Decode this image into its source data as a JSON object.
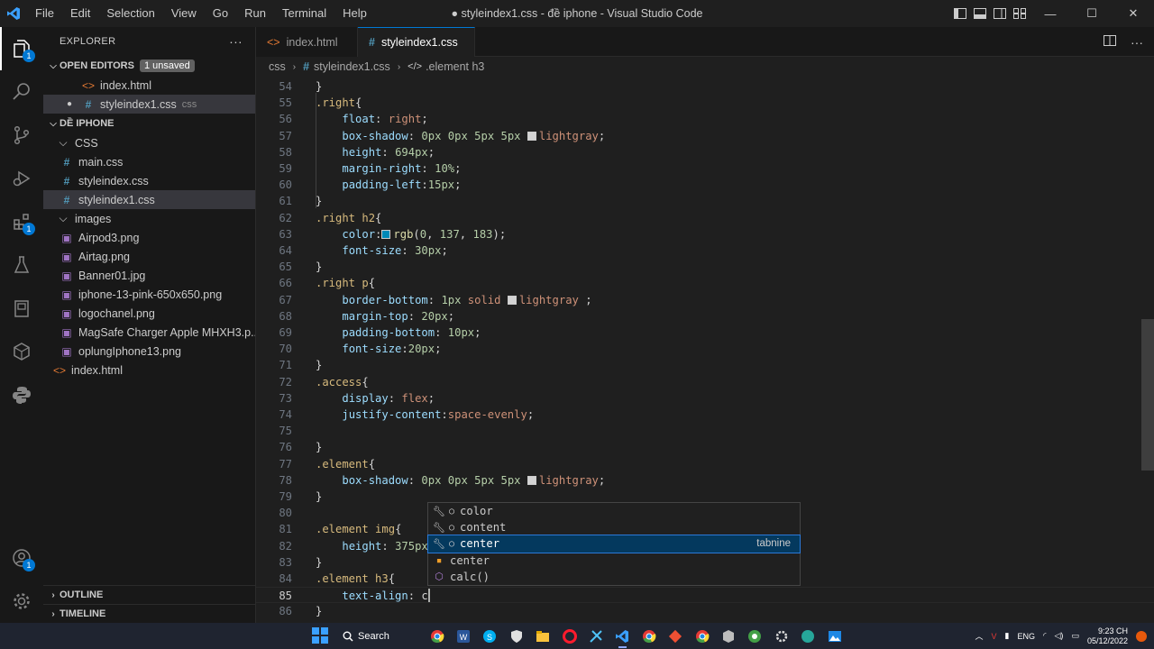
{
  "titlebar": {
    "menu": [
      "File",
      "Edit",
      "Selection",
      "View",
      "Go",
      "Run",
      "Terminal",
      "Help"
    ],
    "window_title": "● styleindex1.css - đề iphone - Visual Studio Code",
    "controls": [
      "—",
      "☐",
      "✕"
    ]
  },
  "activity_bar": {
    "items": [
      "explorer-icon",
      "search-icon",
      "source-control-icon",
      "run-debug-icon",
      "extensions-icon",
      "testing-icon",
      "remote-explorer-icon",
      "docker-icon",
      "python-icon"
    ],
    "explorer_badge": "1",
    "extensions_badge": "1",
    "accounts_badge": "1"
  },
  "sidebar": {
    "title": "EXPLORER",
    "more": "···",
    "open_editors": {
      "label": "OPEN EDITORS",
      "badge": "1 unsaved",
      "files": [
        {
          "name": "index.html",
          "hint": ""
        },
        {
          "name": "styleindex1.css",
          "hint": "css"
        }
      ]
    },
    "workspace": {
      "label": "DỀ IPHONE",
      "css_folder": "CSS",
      "css_files": [
        "main.css",
        "styleindex.css",
        "styleindex1.css"
      ],
      "images_folder": "images",
      "image_files": [
        "Airpod3.png",
        "Airtag.png",
        "Banner01.jpg",
        "iphone-13-pink-650x650.png",
        "logochanel.png",
        "MagSafe Charger Apple MHXH3.p...",
        "oplungIphone13.png"
      ],
      "root_file": "index.html"
    },
    "outline": "OUTLINE",
    "timeline": "TIMELINE"
  },
  "tabs": [
    {
      "name": "index.html",
      "active": false
    },
    {
      "name": "styleindex1.css",
      "active": true,
      "dirty": true
    }
  ],
  "breadcrumb": [
    "css",
    "styleindex1.css",
    ".element h3"
  ],
  "editor": {
    "line_numbers": [
      "54",
      "55",
      "56",
      "57",
      "58",
      "59",
      "60",
      "61",
      "62",
      "63",
      "64",
      "65",
      "66",
      "67",
      "68",
      "69",
      "70",
      "71",
      "72",
      "73",
      "74",
      "75",
      "76",
      "77",
      "78",
      "79",
      "80",
      "81",
      "82",
      "83",
      "84",
      "85",
      "86"
    ],
    "current_line": "85"
  },
  "suggest": {
    "items": [
      {
        "label": "color",
        "kind": "keyword",
        "detail": ""
      },
      {
        "label": "content",
        "kind": "keyword",
        "detail": ""
      },
      {
        "label": "center",
        "kind": "keyword",
        "detail": "tabnine",
        "focused": true
      },
      {
        "label": "center",
        "kind": "value",
        "detail": ""
      },
      {
        "label": "calc()",
        "kind": "function",
        "detail": ""
      }
    ]
  },
  "taskbar": {
    "search_label": "Search",
    "tray_lang": "ENG",
    "time": "9:23 CH",
    "date": "05/12/2022"
  }
}
